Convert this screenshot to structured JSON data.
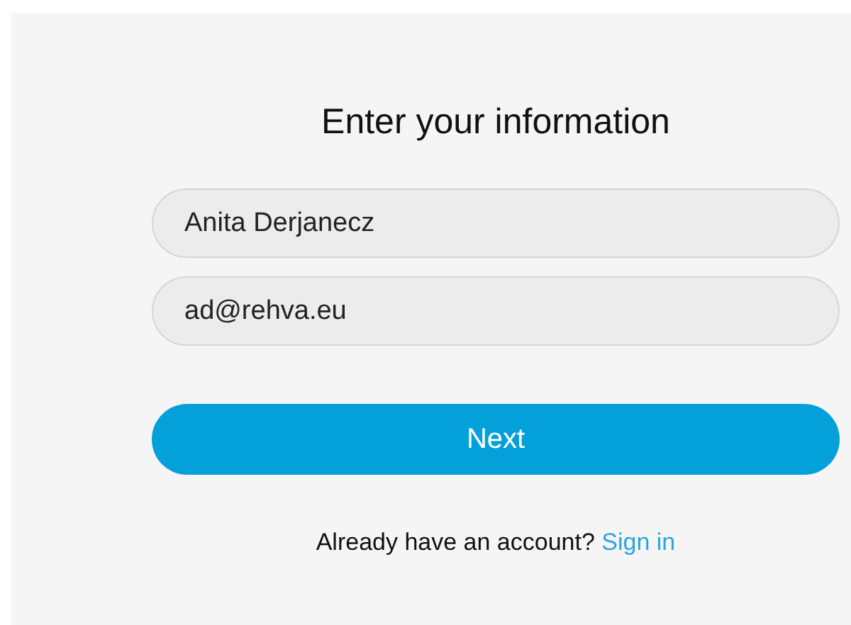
{
  "title": "Enter your information",
  "fields": [
    {
      "value": "Anita Derjanecz"
    },
    {
      "value": "ad@rehva.eu"
    }
  ],
  "next_button": "Next",
  "account_prompt": {
    "text": "Already have an account?",
    "link": "Sign in"
  }
}
